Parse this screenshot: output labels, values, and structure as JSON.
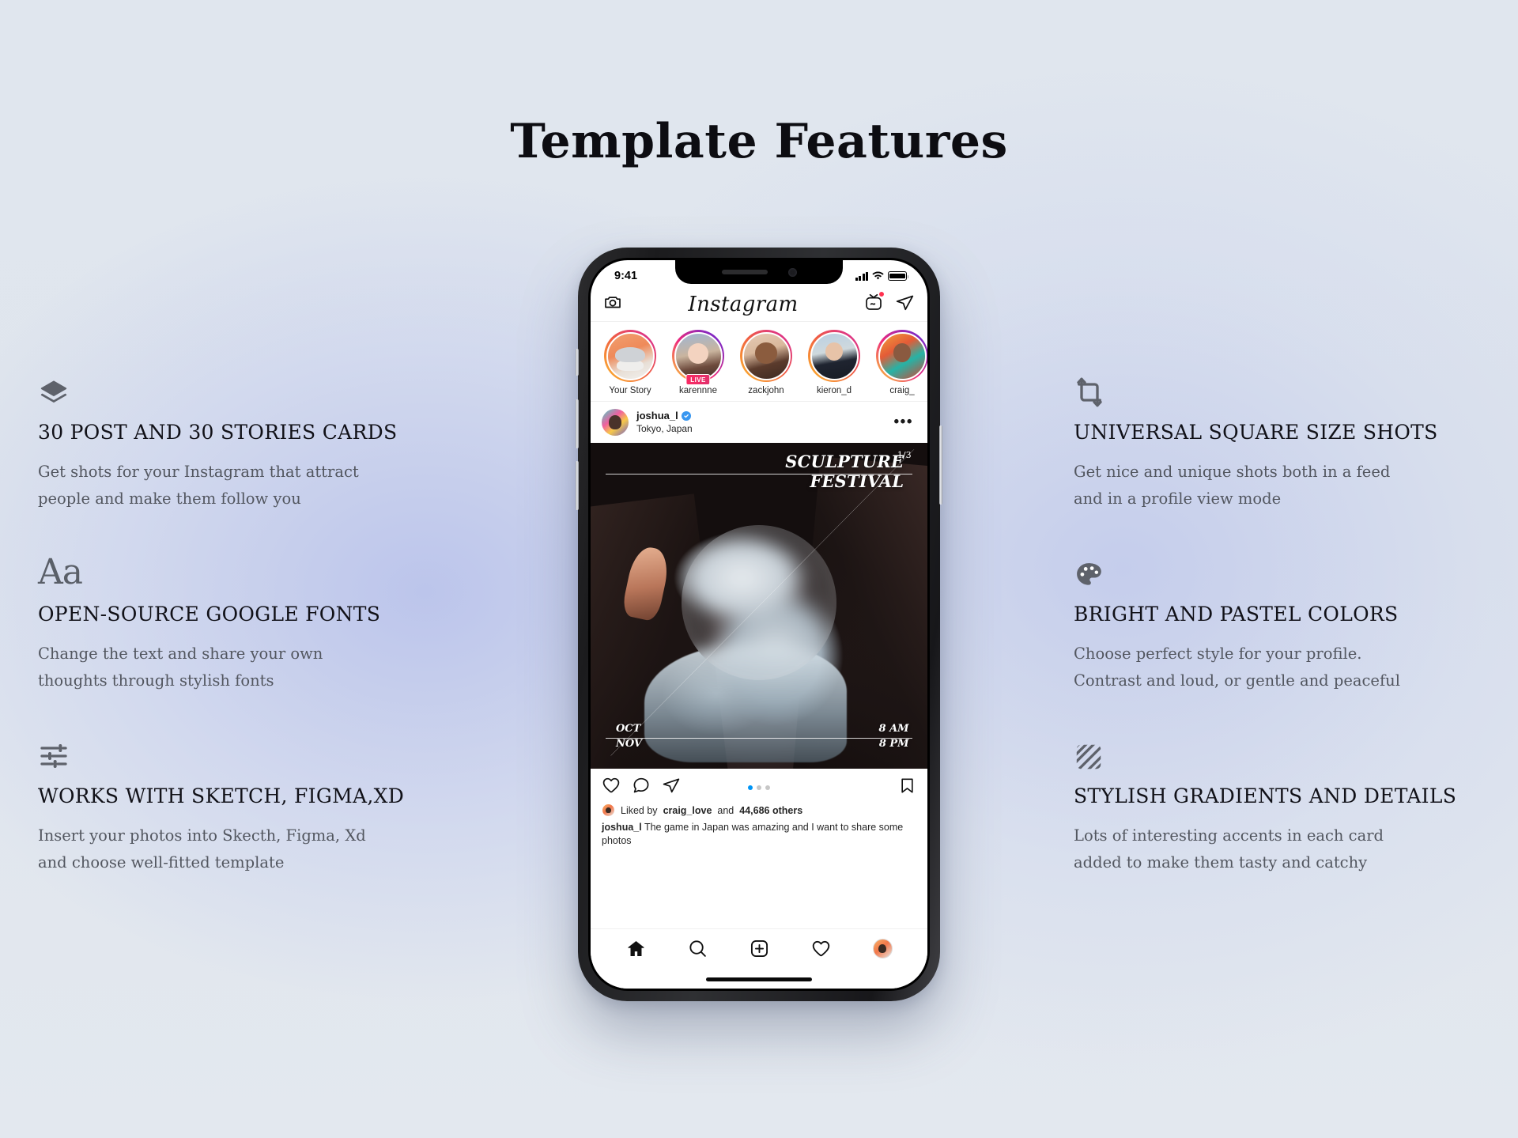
{
  "page": {
    "title": "Template Features",
    "background_color": "#e0e6ee",
    "accent_color": "#c3cbed"
  },
  "features_left": [
    {
      "icon": "layers-icon",
      "title": "30 POST AND 30 STORIES CARDS",
      "body_line1": "Get shots for your Instagram that attract",
      "body_line2": "people and make them follow you"
    },
    {
      "icon": "typography-aa-icon",
      "icon_text": "Aa",
      "title": "OPEN-SOURCE GOOGLE FONTS",
      "body_line1": "Change the text and share your own",
      "body_line2": "thoughts through stylish fonts"
    },
    {
      "icon": "sliders-icon",
      "title": "WORKS WITH SKETCH, FIGMA,XD",
      "body_line1": "Insert your photos into Skecth, Figma, Xd",
      "body_line2": "and choose well-fitted template"
    }
  ],
  "features_right": [
    {
      "icon": "crop-icon",
      "title": "UNIVERSAL SQUARE SIZE SHOTS",
      "body_line1": "Get nice and unique shots both in a feed",
      "body_line2": "and in a profile view mode"
    },
    {
      "icon": "palette-icon",
      "title": "BRIGHT AND PASTEL COLORS",
      "body_line1": "Choose perfect style for your profile.",
      "body_line2": "Contrast and loud, or gentle and peaceful"
    },
    {
      "icon": "gradient-hatch-icon",
      "title": "STYLISH GRADIENTS AND DETAILS",
      "body_line1": "Lots of interesting accents in each card",
      "body_line2": "added to make them tasty and catchy"
    }
  ],
  "phone": {
    "status_bar": {
      "time": "9:41",
      "signal_icon": "cellular-signal-icon",
      "wifi_icon": "wifi-icon",
      "battery_icon": "battery-full-icon"
    },
    "app_header": {
      "camera_icon": "camera-icon",
      "logo": "Instagram",
      "igtv_icon": "igtv-icon",
      "direct_icon": "direct-message-icon",
      "notification_badge_color": "#ff3250"
    },
    "stories": [
      {
        "name": "Your Story",
        "live": ""
      },
      {
        "name": "karennne",
        "live": "LIVE"
      },
      {
        "name": "zackjohn",
        "live": ""
      },
      {
        "name": "kieron_d",
        "live": ""
      },
      {
        "name": "craig_",
        "live": ""
      }
    ],
    "post": {
      "username": "joshua_l",
      "verified": true,
      "location": "Tokyo, Japan",
      "more_label": "•••",
      "image": {
        "title_line1": "SCULPTURE",
        "title_line2": "FESTIVAL",
        "carousel_count": "1/3",
        "bottom_left_line1": "OCT",
        "bottom_left_line2": "NOV",
        "bottom_right_line1": "8 AM",
        "bottom_right_line2": "8 PM"
      },
      "actions": {
        "like_icon": "heart-icon",
        "comment_icon": "comment-icon",
        "share_icon": "share-icon",
        "save_icon": "bookmark-icon",
        "carousel_dots": 3,
        "active_dot": 1,
        "active_dot_color": "#0095f6"
      },
      "likes_prefix": "Liked by",
      "likes_user": "craig_love",
      "likes_join": "and",
      "likes_count": "44,686 others",
      "caption_user": "joshua_l",
      "caption_text": "The game in Japan was amazing and I want to share some photos"
    },
    "tabbar": [
      {
        "icon": "home-icon",
        "active": true
      },
      {
        "icon": "search-icon",
        "active": false
      },
      {
        "icon": "add-post-icon",
        "active": false
      },
      {
        "icon": "activity-heart-icon",
        "active": false
      },
      {
        "icon": "profile-avatar-icon",
        "active": false
      }
    ]
  }
}
